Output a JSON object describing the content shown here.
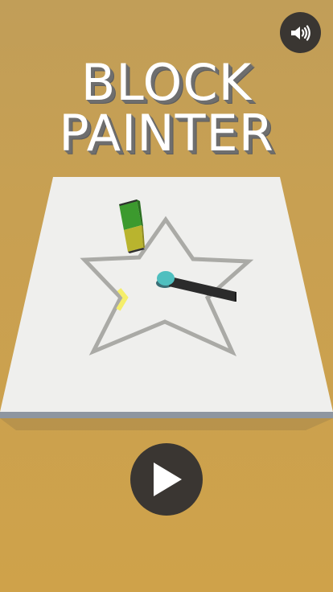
{
  "game": {
    "title_line1": "BLOCK",
    "title_line2": "PAINTER"
  },
  "controls": {
    "sound_icon": "speaker-volume-icon",
    "play_icon": "play-triangle-icon"
  },
  "colors": {
    "background": "#c8a052",
    "board": "#efefed",
    "star_outline": "#aaaaa6",
    "painted_segment": "#f5ee6a",
    "pen_green": "#3c9a2e",
    "pen_yellow": "#b9b42e",
    "handle_cap": "#4fbfbf",
    "button_dark": "#3a3632"
  }
}
